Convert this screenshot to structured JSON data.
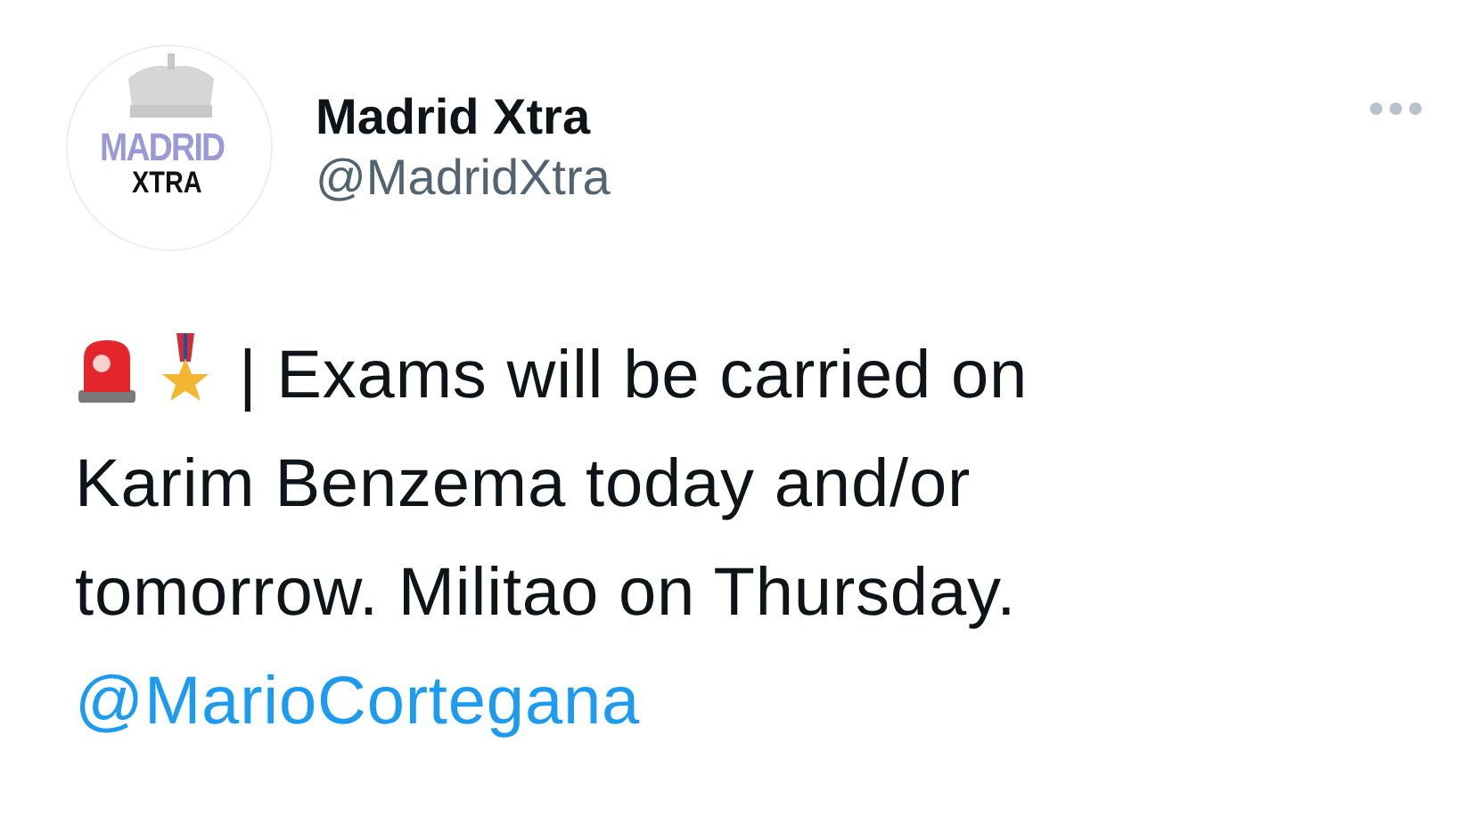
{
  "author": {
    "avatar": {
      "line_1": "MADRID",
      "line_2": "XTRA"
    },
    "name": "Madrid Xtra",
    "handle": "@MadridXtra"
  },
  "tweet": {
    "lines": [
      "| Exams will be carried on",
      "Karim Benzema today and/or",
      "tomorrow. Militao on Thursday."
    ],
    "mention": "@MarioCortegana"
  }
}
